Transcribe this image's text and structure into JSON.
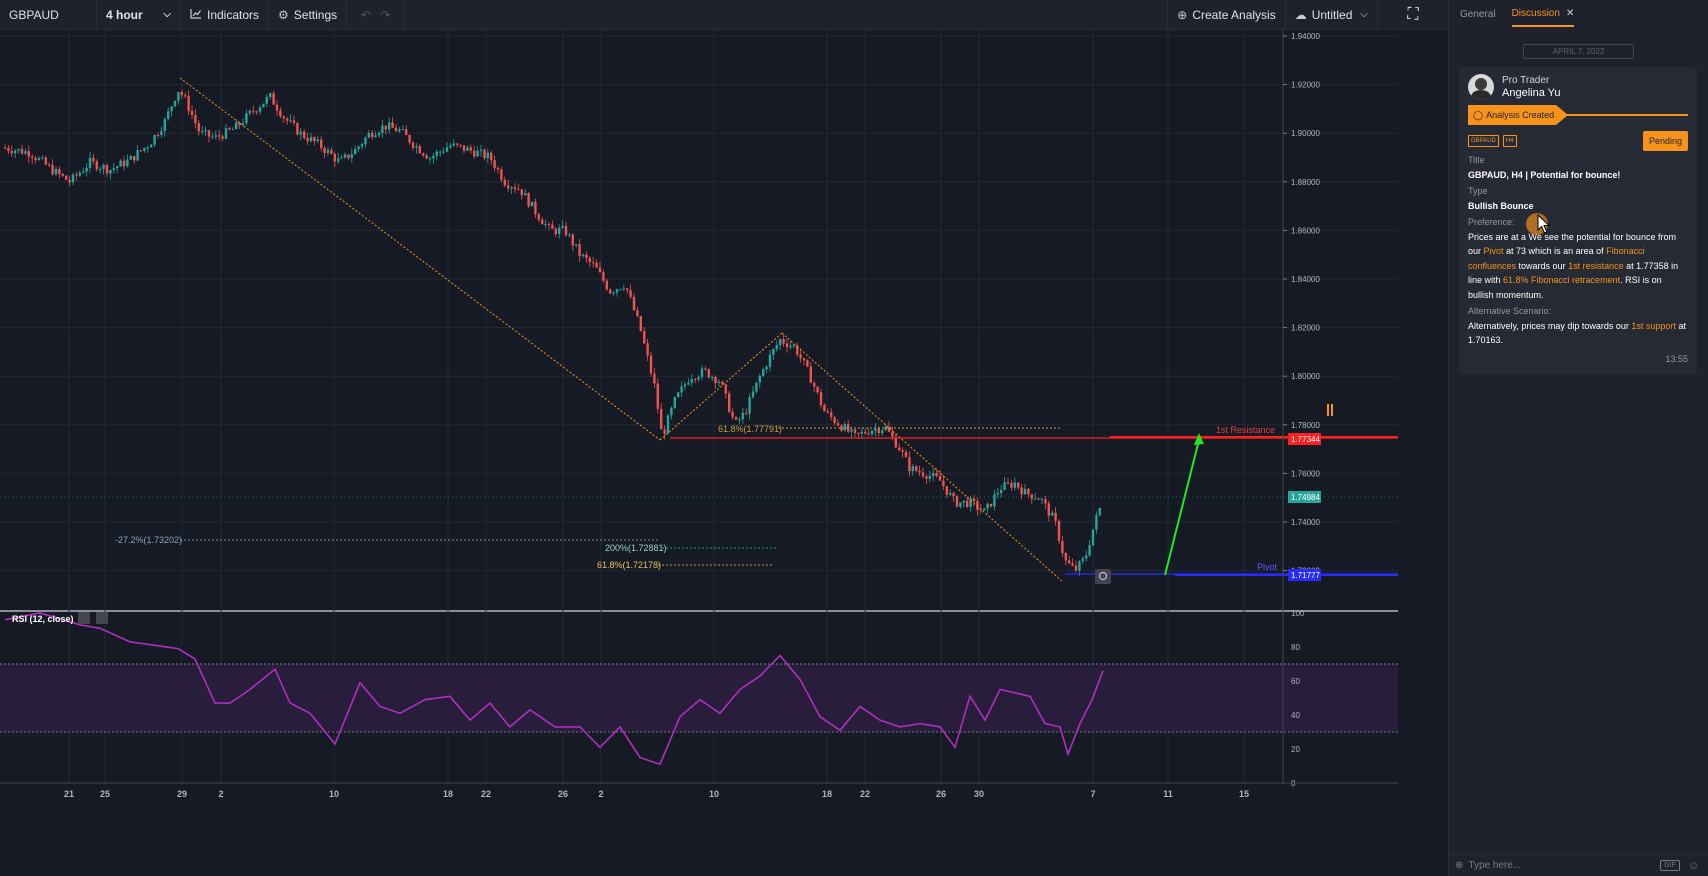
{
  "toolbar": {
    "symbol": "GBPAUD",
    "interval": "4 hour",
    "indicators": "Indicators",
    "settings": "Settings",
    "create_analysis": "Create Analysis",
    "layout_name": "Untitled"
  },
  "icons": {
    "interval_chevron": "chevron-down-icon",
    "indicators": "chart-line-icon",
    "settings": "gear-icon",
    "undo": "undo-icon",
    "redo": "redo-icon",
    "create_analysis": "plus-circle-icon",
    "cloud": "cloud-icon",
    "fullscreen": "fullscreen-icon"
  },
  "price_axis": {
    "labels": [
      "1.94000",
      "1.92000",
      "1.90000",
      "1.88000",
      "1.86000",
      "1.84000",
      "1.82000",
      "1.80000",
      "1.78000",
      "1.76000",
      "1.74000",
      "1.72000"
    ],
    "badges": {
      "resistance": "1.77344",
      "current": "1.74984",
      "pivot": "1.71777"
    }
  },
  "rsi_axis": {
    "labels": [
      "100",
      "80",
      "60",
      "40",
      "20",
      "0"
    ]
  },
  "time_axis": {
    "labels": [
      "21",
      "25",
      "29",
      "2",
      "10",
      "18",
      "22",
      "26",
      "2",
      "10",
      "18",
      "22",
      "26",
      "30",
      "7",
      "11",
      "15"
    ]
  },
  "annotations": {
    "fib_top": "61.8%(1.77791)",
    "fib_neg": "-27.2%(1.73202)",
    "fib_200": "200%(1.72881)",
    "fib_618": "61.8%(1.72178)",
    "resistance": "1st Resistance",
    "pivot": "Pivot"
  },
  "rsi_label": "RSI (12, close)",
  "colors": {
    "up": "#26a69a",
    "down": "#ef5350",
    "accent": "#f7931a",
    "rsi": "#b02fc0",
    "resistance": "#ff2020",
    "pivot": "#2a2aff",
    "arrow": "#22e822"
  },
  "sidebar": {
    "tabs": [
      "General",
      "Discussion"
    ],
    "date": "APRIL 7, 2022",
    "role": "Pro Trader",
    "author": "Angelina Yu",
    "status": "Analysis Created",
    "tags": [
      "GBPAUD",
      "H4"
    ],
    "badge": "Pending",
    "title_label": "Title",
    "title": "GBPAUD, H4 | Potential for bounce!",
    "type_label": "Type",
    "type": "Bullish Bounce",
    "pref_label": "Preference:",
    "pref": {
      "t1": "Prices are at a",
      "t2": " We see the potential for bounce from our ",
      "pivot": "Pivot",
      "t3": " at ",
      "t4": "73 which is an area of ",
      "fib": "Fibonacci confluences",
      "t5": " towards our ",
      "res": "1st resistance",
      "t6": " at 1.77358 in line with ",
      "fib2": "61.8% Fibonacci retracement",
      "t7": ". RSI is on bullish momentum."
    },
    "alt_label": "Alternative Scenario:",
    "alt": {
      "t1": "Alternatively, prices may dip towards our ",
      "sup": "1st support",
      "t2": " at 1.70163."
    },
    "time": "13:55",
    "composer": "Type here...",
    "gif": "GIF"
  }
}
